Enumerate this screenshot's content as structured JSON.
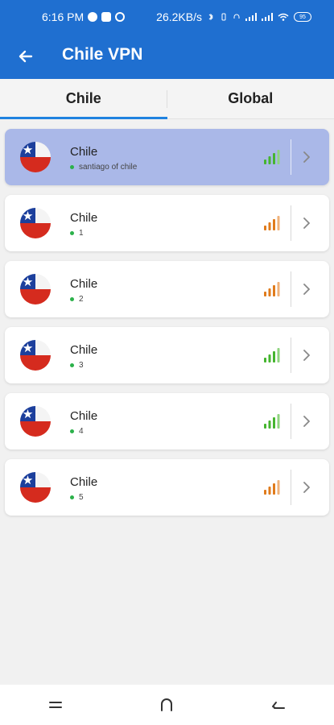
{
  "status_bar": {
    "time": "6:16 PM",
    "network_speed": "26.2KB/s",
    "battery": "95"
  },
  "header": {
    "title": "Chile VPN"
  },
  "tabs": [
    {
      "label": "Chile",
      "active": true
    },
    {
      "label": "Global",
      "active": false
    }
  ],
  "servers": [
    {
      "name": "Chile",
      "subtitle": "santiago of chile",
      "signal": "good",
      "selected": true
    },
    {
      "name": "Chile",
      "subtitle": "1",
      "signal": "medium",
      "selected": false
    },
    {
      "name": "Chile",
      "subtitle": "2",
      "signal": "medium",
      "selected": false
    },
    {
      "name": "Chile",
      "subtitle": "3",
      "signal": "good",
      "selected": false
    },
    {
      "name": "Chile",
      "subtitle": "4",
      "signal": "good",
      "selected": false
    },
    {
      "name": "Chile",
      "subtitle": "5",
      "signal": "medium",
      "selected": false
    }
  ],
  "colors": {
    "appbar": "#1f6fd0",
    "tab_indicator": "#1f82e0",
    "selected_row": "#aab8e8",
    "signal_good": "#45b52f",
    "signal_medium": "#e07b1c",
    "online_dot": "#2bb14a"
  },
  "nav_icons": [
    "menu-icon",
    "home-icon",
    "back-icon"
  ]
}
